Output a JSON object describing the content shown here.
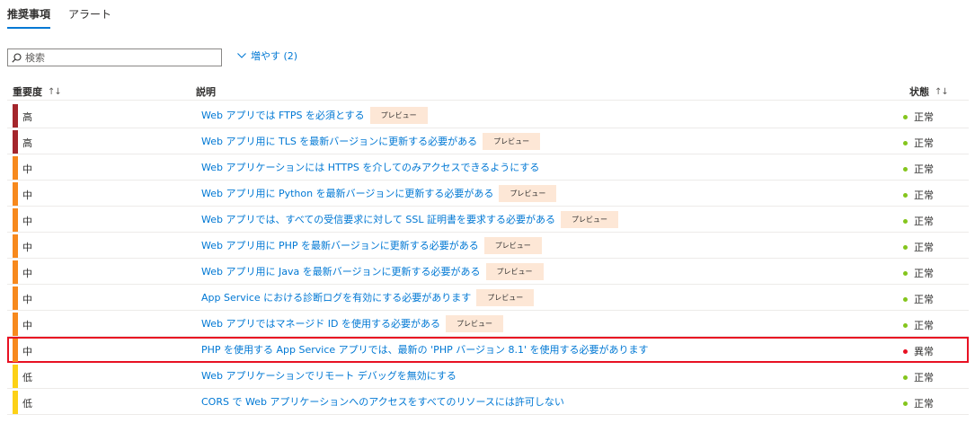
{
  "tabs": [
    {
      "label": "推奨事項",
      "active": true
    },
    {
      "label": "アラート",
      "active": false
    }
  ],
  "search": {
    "placeholder": "検索",
    "icon": "search-icon"
  },
  "expand": {
    "label": "増やす (2)",
    "icon": "chevron-down-icon"
  },
  "columns": {
    "severity": "重要度",
    "description": "説明",
    "status": "状態"
  },
  "colors": {
    "high": "#a4262c",
    "medium": "#f7891d",
    "low": "#fcd116",
    "link": "#0078d4",
    "badge_bg": "#fde7d6",
    "healthy": "#84c51d",
    "unhealthy": "#e81123",
    "highlight": "#e81123"
  },
  "rows": [
    {
      "severity": "高",
      "level": "high",
      "description": "Web アプリでは FTPS を必須とする",
      "badge": "プレビュー",
      "status": "正常",
      "state": "healthy",
      "highlighted": false
    },
    {
      "severity": "高",
      "level": "high",
      "description": "Web アプリ用に TLS を最新バージョンに更新する必要がある",
      "badge": "プレビュー",
      "status": "正常",
      "state": "healthy",
      "highlighted": false
    },
    {
      "severity": "中",
      "level": "medium",
      "description": "Web アプリケーションには HTTPS を介してのみアクセスできるようにする",
      "badge": "",
      "status": "正常",
      "state": "healthy",
      "highlighted": false
    },
    {
      "severity": "中",
      "level": "medium",
      "description": "Web アプリ用に Python を最新バージョンに更新する必要がある",
      "badge": "プレビュー",
      "status": "正常",
      "state": "healthy",
      "highlighted": false
    },
    {
      "severity": "中",
      "level": "medium",
      "description": "Web アプリでは、すべての受信要求に対して SSL 証明書を要求する必要がある",
      "badge": "プレビュー",
      "status": "正常",
      "state": "healthy",
      "highlighted": false
    },
    {
      "severity": "中",
      "level": "medium",
      "description": "Web アプリ用に PHP を最新バージョンに更新する必要がある",
      "badge": "プレビュー",
      "status": "正常",
      "state": "healthy",
      "highlighted": false
    },
    {
      "severity": "中",
      "level": "medium",
      "description": "Web アプリ用に Java を最新バージョンに更新する必要がある",
      "badge": "プレビュー",
      "status": "正常",
      "state": "healthy",
      "highlighted": false
    },
    {
      "severity": "中",
      "level": "medium",
      "description": "App Service における診断ログを有効にする必要があります",
      "badge": "プレビュー",
      "status": "正常",
      "state": "healthy",
      "highlighted": false
    },
    {
      "severity": "中",
      "level": "medium",
      "description": "Web アプリではマネージド ID を使用する必要がある",
      "badge": "プレビュー",
      "status": "正常",
      "state": "healthy",
      "highlighted": false
    },
    {
      "severity": "中",
      "level": "medium",
      "description": "PHP を使用する App Service アプリでは、最新の 'PHP バージョン 8.1' を使用する必要があります",
      "badge": "",
      "status": "異常",
      "state": "unhealthy",
      "highlighted": true
    },
    {
      "severity": "低",
      "level": "low",
      "description": "Web アプリケーションでリモート デバッグを無効にする",
      "badge": "",
      "status": "正常",
      "state": "healthy",
      "highlighted": false
    },
    {
      "severity": "低",
      "level": "low",
      "description": "CORS で Web アプリケーションへのアクセスをすべてのリソースには許可しない",
      "badge": "",
      "status": "正常",
      "state": "healthy",
      "highlighted": false
    }
  ]
}
